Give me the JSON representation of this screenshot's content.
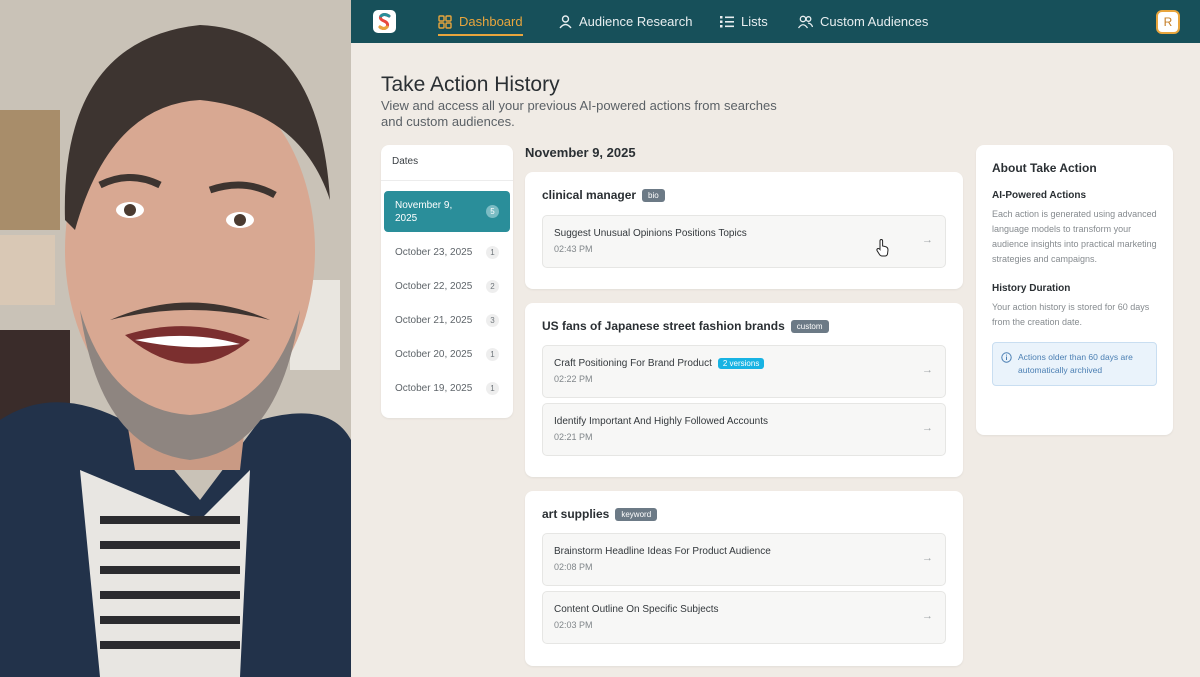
{
  "nav": {
    "items": [
      {
        "label": "Dashboard",
        "icon": "grid-icon",
        "active": true
      },
      {
        "label": "Audience Research",
        "icon": "user-icon",
        "active": false
      },
      {
        "label": "Lists",
        "icon": "list-icon",
        "active": false
      },
      {
        "label": "Custom Audiences",
        "icon": "users-icon",
        "active": false
      }
    ],
    "avatar_initial": "R"
  },
  "page": {
    "title": "Take Action History",
    "subtitle": "View and access all your previous AI-powered actions from searches and custom audiences."
  },
  "dates": {
    "heading": "Dates",
    "items": [
      {
        "label": "November 9, 2025",
        "count": "5",
        "active": true
      },
      {
        "label": "October 23, 2025",
        "count": "1",
        "active": false
      },
      {
        "label": "October 22, 2025",
        "count": "2",
        "active": false
      },
      {
        "label": "October 21, 2025",
        "count": "3",
        "active": false
      },
      {
        "label": "October 20, 2025",
        "count": "1",
        "active": false
      },
      {
        "label": "October 19, 2025",
        "count": "1",
        "active": false
      }
    ]
  },
  "section_date": "November 9, 2025",
  "groups": [
    {
      "title": "clinical manager",
      "tag": "bio",
      "actions": [
        {
          "name": "Suggest Unusual Opinions Positions Topics",
          "time": "02:43 PM",
          "badge": ""
        }
      ]
    },
    {
      "title": "US fans of Japanese street fashion brands",
      "tag": "custom",
      "actions": [
        {
          "name": "Craft Positioning For Brand Product",
          "time": "02:22 PM",
          "badge": "2 versions"
        },
        {
          "name": "Identify Important And Highly Followed Accounts",
          "time": "02:21 PM",
          "badge": ""
        }
      ]
    },
    {
      "title": "art supplies",
      "tag": "keyword",
      "actions": [
        {
          "name": "Brainstorm Headline Ideas For Product Audience",
          "time": "02:08 PM",
          "badge": ""
        },
        {
          "name": "Content Outline On Specific Subjects",
          "time": "02:03 PM",
          "badge": ""
        }
      ]
    }
  ],
  "about": {
    "title": "About Take Action",
    "sections": [
      {
        "heading": "AI-Powered Actions",
        "text": "Each action is generated using advanced language models to transform your audience insights into practical marketing strategies and campaigns."
      },
      {
        "heading": "History Duration",
        "text": "Your action history is stored for 60 days from the creation date."
      }
    ],
    "info": "Actions older than 60 days are automatically archived"
  },
  "colors": {
    "nav_bg": "#17505a",
    "accent": "#e8a53d",
    "active_date": "#2a8e9a"
  }
}
